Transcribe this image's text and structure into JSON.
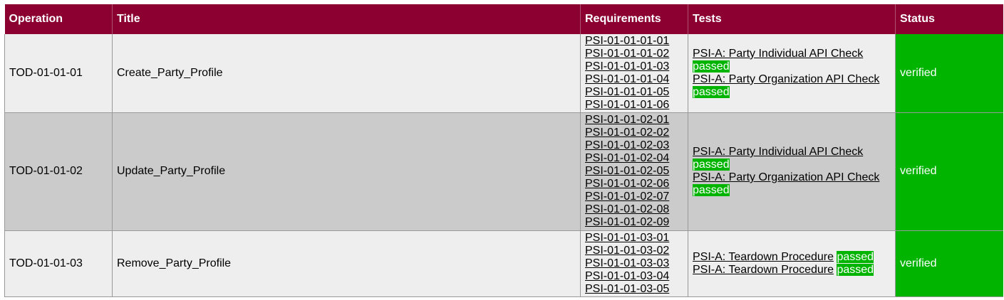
{
  "headers": [
    "Operation",
    "Title",
    "Requirements",
    "Tests",
    "Status"
  ],
  "rows": [
    {
      "operation": "TOD-01-01-01",
      "title": "Create_Party_Profile",
      "requirements": [
        "PSI-01-01-01-01",
        "PSI-01-01-01-02",
        "PSI-01-01-01-03",
        "PSI-01-01-01-04",
        "PSI-01-01-01-05",
        "PSI-01-01-01-06"
      ],
      "tests": [
        {
          "name": "PSI-A: Party Individual API Check",
          "result": "passed"
        },
        {
          "name": "PSI-A: Party Organization API Check",
          "result": "passed"
        }
      ],
      "status": "verified"
    },
    {
      "operation": "TOD-01-01-02",
      "title": "Update_Party_Profile",
      "requirements": [
        "PSI-01-01-02-01",
        "PSI-01-01-02-02",
        "PSI-01-01-02-03",
        "PSI-01-01-02-04",
        "PSI-01-01-02-05",
        "PSI-01-01-02-06",
        "PSI-01-01-02-07",
        "PSI-01-01-02-08",
        "PSI-01-01-02-09"
      ],
      "tests": [
        {
          "name": "PSI-A: Party Individual API Check",
          "result": "passed"
        },
        {
          "name": "PSI-A: Party Organization API Check",
          "result": "passed"
        }
      ],
      "status": "verified"
    },
    {
      "operation": "TOD-01-01-03",
      "title": "Remove_Party_Profile",
      "requirements": [
        "PSI-01-01-03-01",
        "PSI-01-01-03-02",
        "PSI-01-01-03-03",
        "PSI-01-01-03-04",
        "PSI-01-01-03-05"
      ],
      "tests": [
        {
          "name": "PSI-A: Teardown Procedure",
          "result": "passed"
        },
        {
          "name": "PSI-A: Teardown Procedure",
          "result": "passed"
        }
      ],
      "status": "verified"
    }
  ],
  "colors": {
    "header_bg": "#8b0030",
    "verified_bg": "#00b400",
    "passed_bg": "#00b400",
    "row_light": "#eeeeee",
    "row_dark": "#cbcbcb"
  }
}
